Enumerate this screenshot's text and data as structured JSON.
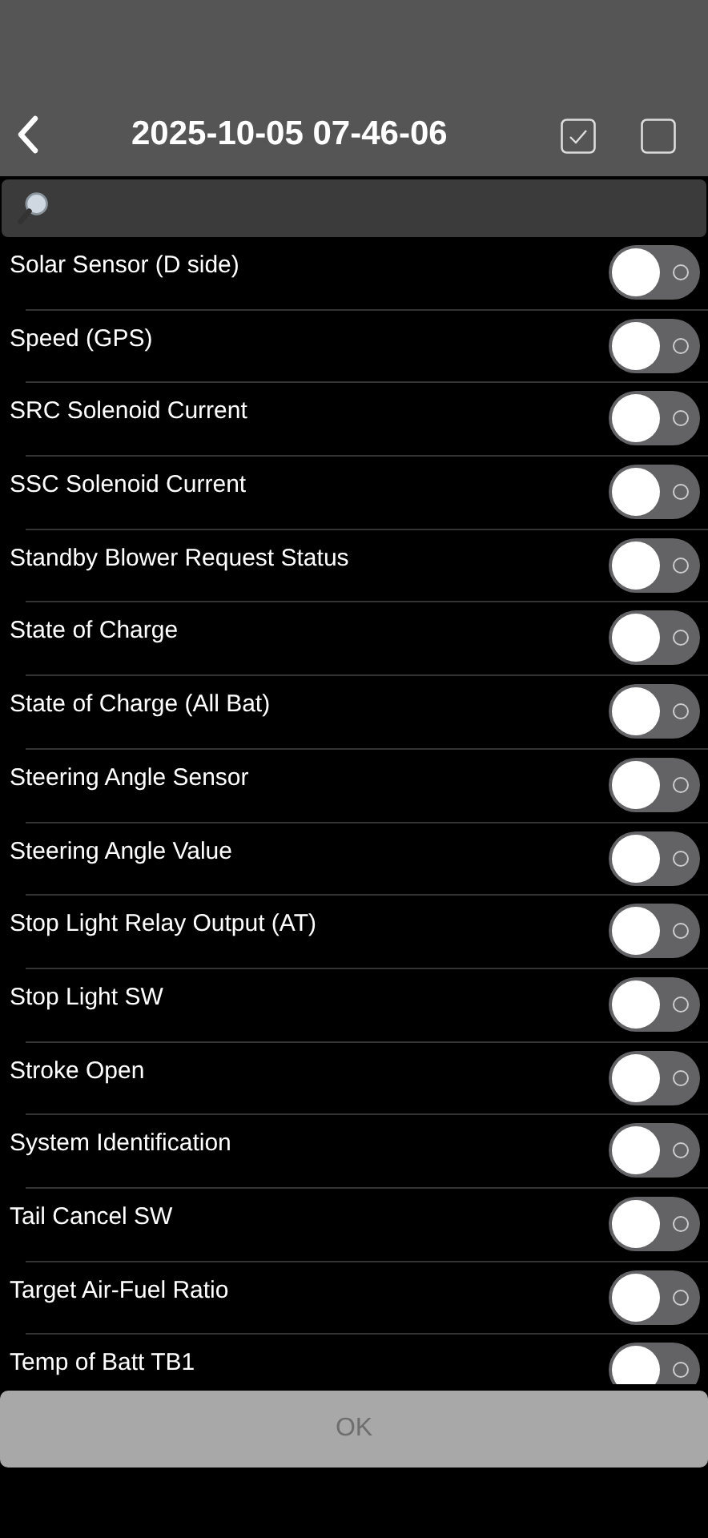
{
  "header": {
    "title": "2025-10-05 07-46-06"
  },
  "items": [
    {
      "label": "Solar Sensor (D side)",
      "on": false
    },
    {
      "label": "Speed (GPS)",
      "on": false
    },
    {
      "label": "SRC Solenoid Current",
      "on": false
    },
    {
      "label": "SSC Solenoid Current",
      "on": false
    },
    {
      "label": "Standby Blower Request Status",
      "on": false
    },
    {
      "label": "State of Charge",
      "on": false
    },
    {
      "label": "State of Charge (All Bat)",
      "on": false
    },
    {
      "label": "Steering Angle Sensor",
      "on": false
    },
    {
      "label": "Steering Angle Value",
      "on": false
    },
    {
      "label": "Stop Light Relay Output (AT)",
      "on": false
    },
    {
      "label": "Stop Light SW",
      "on": false
    },
    {
      "label": "Stroke Open",
      "on": false
    },
    {
      "label": "System Identification",
      "on": false
    },
    {
      "label": "Tail Cancel SW",
      "on": false
    },
    {
      "label": "Target Air-Fuel Ratio",
      "on": false
    },
    {
      "label": "Temp of Batt TB1",
      "on": false
    }
  ],
  "ok_button": {
    "label": "OK",
    "disabled": true
  }
}
